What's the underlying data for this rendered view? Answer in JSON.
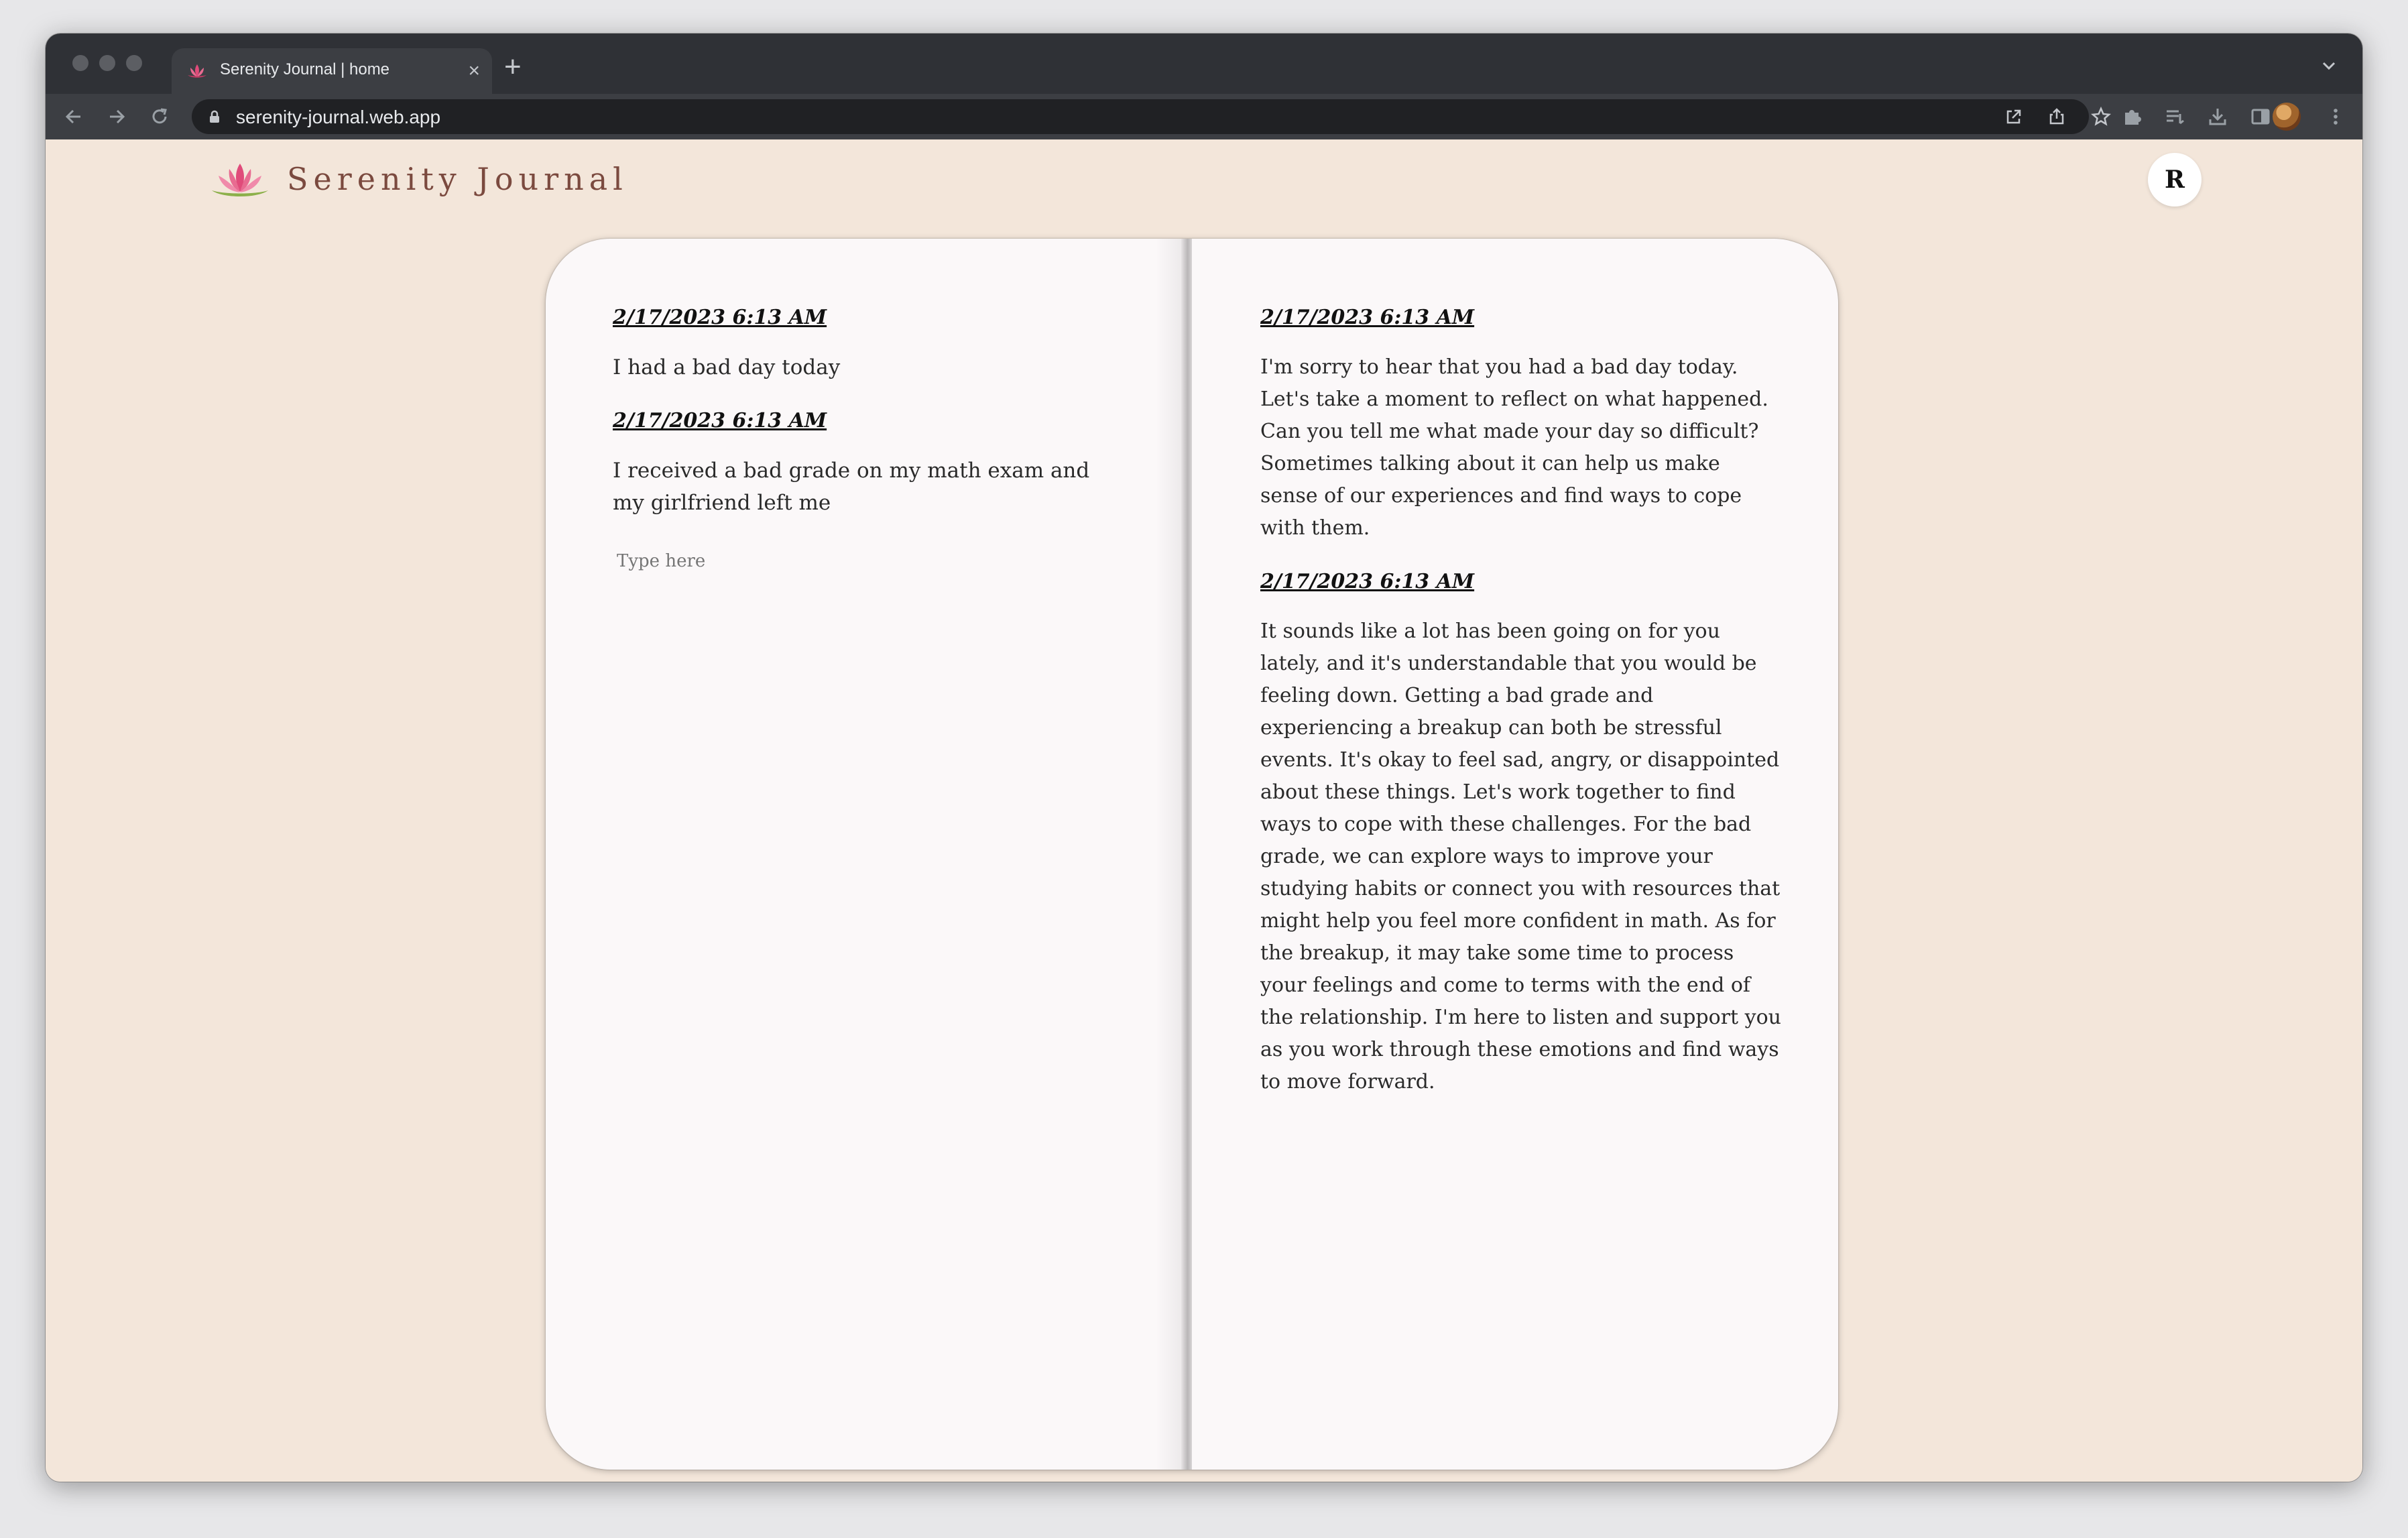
{
  "browser": {
    "tab_title": "Serenity Journal | home",
    "url": "serenity-journal.web.app",
    "new_tab_label": "+",
    "close_label": "×"
  },
  "header": {
    "app_name": "Serenity Journal",
    "avatar_initial": "R"
  },
  "journal": {
    "left_entries": [
      {
        "timestamp": "2/17/2023 6:13 AM",
        "text": "I had a bad day today"
      },
      {
        "timestamp": "2/17/2023 6:13 AM",
        "text": "I received a bad grade on my math exam and my girlfriend left me"
      }
    ],
    "input_placeholder": "Type here",
    "right_entries": [
      {
        "timestamp": "2/17/2023 6:13 AM",
        "text": "I'm sorry to hear that you had a bad day today. Let's take a moment to reflect on what happened. Can you tell me what made your day so difficult? Sometimes talking about it can help us make sense of our experiences and find ways to cope with them."
      },
      {
        "timestamp": "2/17/2023 6:13 AM",
        "text": "It sounds like a lot has been going on for you lately, and it's understandable that you would be feeling down. Getting a bad grade and experiencing a breakup can both be stressful events. It's okay to feel sad, angry, or disappointed about these things. Let's work together to find ways to cope with these challenges. For the bad grade, we can explore ways to improve your studying habits or connect you with resources that might help you feel more confident in math. As for the breakup, it may take some time to process your feelings and come to terms with the end of the relationship. I'm here to listen and support you as you work through these emotions and find ways to move forward."
      }
    ]
  },
  "colors": {
    "page_background": "#f3e6da",
    "logo_text": "#7b4a3f",
    "lotus_pink": "#e04b7a",
    "lotus_leaf": "#8cb04a"
  },
  "icons": {
    "back": "arrow-left-icon",
    "forward": "arrow-right-icon",
    "reload": "reload-icon",
    "lock": "lock-icon",
    "open_external": "open-external-icon",
    "share": "share-icon",
    "bookmark": "star-icon",
    "extensions": "puzzle-icon",
    "reading_list": "reading-list-icon",
    "downloads": "download-icon",
    "side_panel": "side-panel-icon",
    "menu": "kebab-menu-icon",
    "logo": "lotus-icon"
  }
}
